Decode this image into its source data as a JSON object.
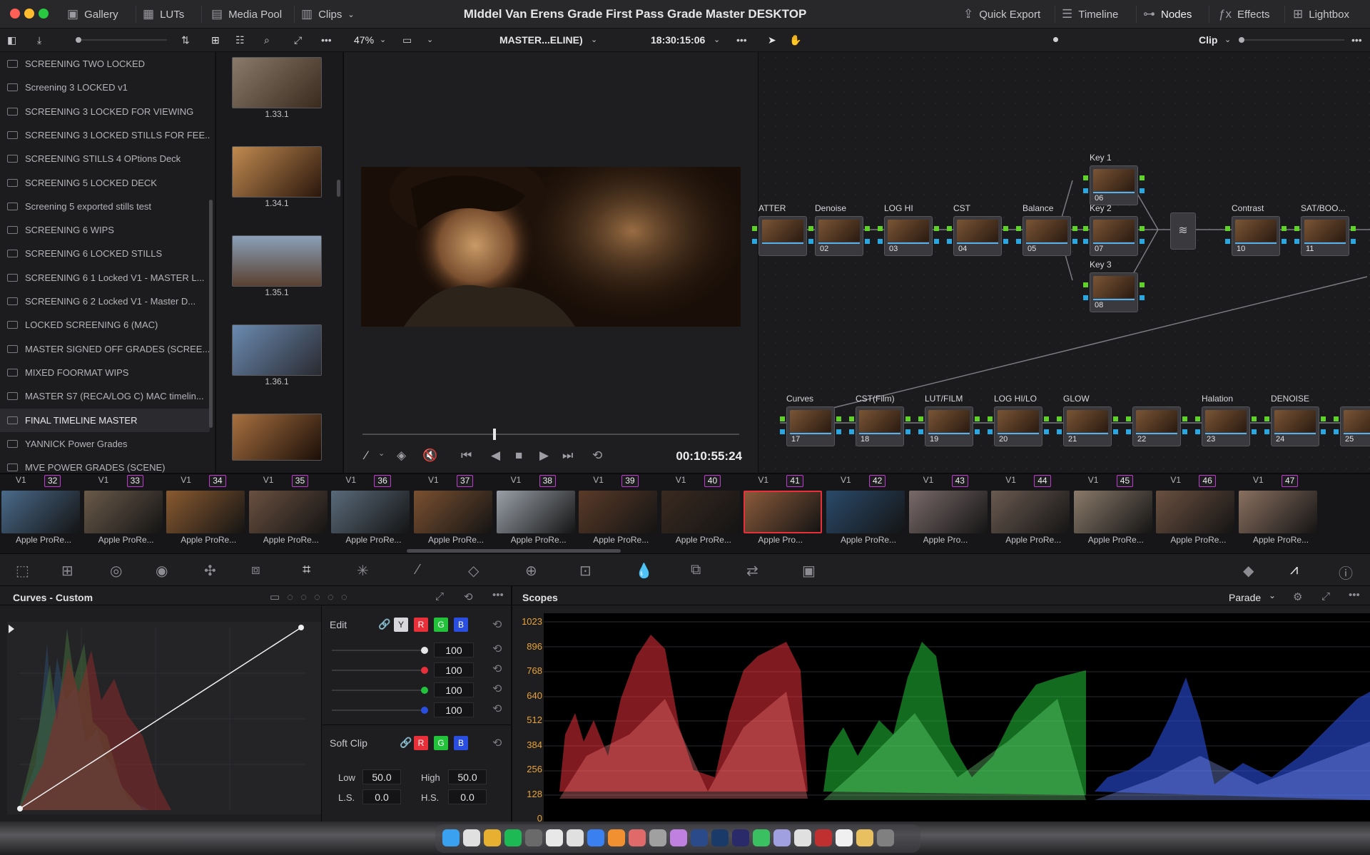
{
  "window": {
    "title": "MIddel Van Erens Grade First Pass Grade Master DESKTOP"
  },
  "topbar": {
    "gallery": "Gallery",
    "luts": "LUTs",
    "media_pool": "Media Pool",
    "clips": "Clips",
    "quick_export": "Quick Export",
    "timeline": "Timeline",
    "nodes": "Nodes",
    "effects": "Effects",
    "lightbox": "Lightbox"
  },
  "viewer_toolbar": {
    "zoom": "47%",
    "timeline_name": "MASTER...ELINE)",
    "timecode_top": "18:30:15:06",
    "mode": "Clip"
  },
  "gallery_albums": [
    "SCREENING TWO LOCKED",
    "Screening 3 LOCKED v1",
    "SCREENING 3 LOCKED FOR VIEWING",
    "SCREENING 3 LOCKED STILLS FOR FEE...",
    "SCREENING STILLS 4 OPtions Deck",
    "SCREENING 5 LOCKED DECK",
    "Screening 5 exported stills test",
    "SCREENING 6 WIPS",
    "SCREENING 6 LOCKED STILLS",
    "SCREENING 6 1 Locked V1 - MASTER L...",
    "SCREENING 6 2 Locked V1 - Master D...",
    "LOCKED SCREENING 6 (MAC)",
    "MASTER SIGNED OFF GRADES (SCREE...",
    "MIXED FOORMAT WIPS",
    "MASTER S7 (RECA/LOG C) MAC timelin...",
    "FINAL TIMELINE MASTER",
    "YANNICK Power Grades",
    "MVE POWER GRADES (SCENE)"
  ],
  "stills": [
    "1.33.1",
    "1.34.1",
    "1.35.1",
    "1.36.1"
  ],
  "viewer": {
    "timecode": "00:10:55:24"
  },
  "nodes_top": [
    {
      "label": "ATTER",
      "num": ""
    },
    {
      "label": "Denoise",
      "num": "02"
    },
    {
      "label": "LOG HI",
      "num": "03"
    },
    {
      "label": "CST",
      "num": "04"
    },
    {
      "label": "Balance",
      "num": "05"
    },
    {
      "label": "Contrast",
      "num": "10"
    },
    {
      "label": "SAT/BOO...",
      "num": "11"
    }
  ],
  "nodes_keys": [
    {
      "label": "Key 1",
      "num": "06"
    },
    {
      "label": "Key 2",
      "num": "07"
    },
    {
      "label": "Key 3",
      "num": "08"
    }
  ],
  "nodes_bottom": [
    {
      "label": "Curves",
      "num": "17"
    },
    {
      "label": "CST(Film)",
      "num": "18"
    },
    {
      "label": "LUT/FILM",
      "num": "19"
    },
    {
      "label": "LOG HI/LO",
      "num": "20"
    },
    {
      "label": "GLOW",
      "num": "21"
    },
    {
      "label": "",
      "num": "22"
    },
    {
      "label": "Halation",
      "num": "23"
    },
    {
      "label": "DENOISE",
      "num": "24"
    },
    {
      "label": "",
      "num": "25"
    }
  ],
  "clips": [
    {
      "num": "32",
      "track": "V1",
      "label": "Apple ProRe..."
    },
    {
      "num": "33",
      "track": "V1",
      "label": "Apple ProRe..."
    },
    {
      "num": "34",
      "track": "V1",
      "label": "Apple ProRe..."
    },
    {
      "num": "35",
      "track": "V1",
      "label": "Apple ProRe..."
    },
    {
      "num": "36",
      "track": "V1",
      "label": "Apple ProRe..."
    },
    {
      "num": "37",
      "track": "V1",
      "label": "Apple ProRe..."
    },
    {
      "num": "38",
      "track": "V1",
      "label": "Apple ProRe..."
    },
    {
      "num": "39",
      "track": "V1",
      "label": "Apple ProRe..."
    },
    {
      "num": "40",
      "track": "V1",
      "label": "Apple ProRe..."
    },
    {
      "num": "41",
      "track": "V1",
      "label": "Apple Pro..."
    },
    {
      "num": "42",
      "track": "V1",
      "label": "Apple ProRe..."
    },
    {
      "num": "43",
      "track": "V1",
      "label": "Apple Pro..."
    },
    {
      "num": "44",
      "track": "V1",
      "label": "Apple ProRe..."
    },
    {
      "num": "45",
      "track": "V1",
      "label": "Apple ProRe..."
    },
    {
      "num": "46",
      "track": "V1",
      "label": "Apple ProRe..."
    },
    {
      "num": "47",
      "track": "V1",
      "label": "Apple ProRe..."
    }
  ],
  "curves": {
    "title": "Curves - Custom",
    "edit": "Edit",
    "channels": [
      "Y",
      "R",
      "G",
      "B"
    ],
    "intensity": [
      "100",
      "100",
      "100",
      "100"
    ],
    "soft_clip": "Soft Clip",
    "low_label": "Low",
    "low": "50.0",
    "high_label": "High",
    "high": "50.0",
    "ls_label": "L.S.",
    "ls": "0.0",
    "hs_label": "H.S.",
    "hs": "0.0"
  },
  "scopes": {
    "title": "Scopes",
    "mode": "Parade",
    "scale": [
      "1023",
      "896",
      "768",
      "640",
      "512",
      "384",
      "256",
      "128",
      "0"
    ]
  },
  "colors": {
    "red": "#e8303a",
    "green": "#22c23a",
    "blue": "#2a4fe0",
    "accent_clip": "#c23bd1",
    "scale": "#e8a338"
  }
}
